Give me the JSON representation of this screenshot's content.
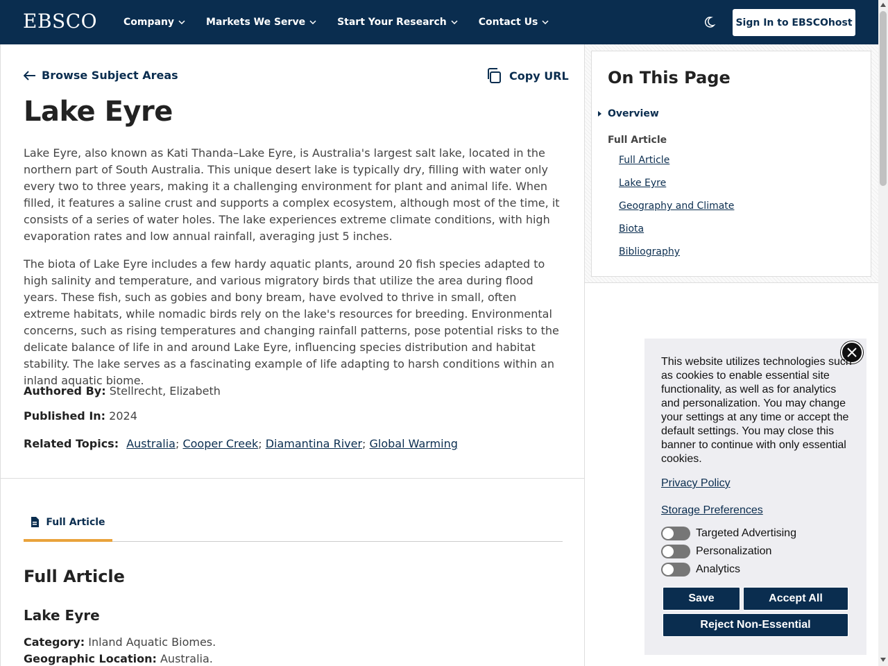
{
  "header": {
    "logo": "EBSCO",
    "nav": [
      "Company",
      "Markets We Serve",
      "Start Your Research",
      "Contact Us"
    ],
    "signin_label": "Sign In to EBSCOhost"
  },
  "article": {
    "back_label": "Browse Subject Areas",
    "copy_label": "Copy URL",
    "title": "Lake Eyre",
    "paragraph1": "Lake Eyre, also known as Kati Thanda–Lake Eyre, is Australia's largest salt lake, located in the northern part of South Australia. This unique desert lake is typically dry, filling with water only every two to three years, making it a challenging environment for plant and animal life. When filled, it features a saline crust and supports a complex ecosystem, although most of the time, it consists of a series of water holes. The lake experiences extreme climate conditions, with high evaporation rates and low annual rainfall, averaging just 5 inches.",
    "paragraph2": "The biota of Lake Eyre includes a few hardy aquatic plants, around 20 fish species adapted to high salinity and temperature, and various migratory birds that utilize the area during flood years. These fish, such as gobies and bony bream, have evolved to thrive in small, often extreme habitats, while nomadic birds rely on the lake's resources for breeding. Environmental concerns, such as rising temperatures and changing rainfall patterns, pose potential risks to the delicate balance of life in and around Lake Eyre, influencing species distribution and habitat stability. The lake serves as a fascinating example of life adapting to harsh conditions within an inland aquatic biome.",
    "authored_label": "Authored By:",
    "author": "Stellrecht, Elizabeth",
    "published_label": "Published In:",
    "published": "2024",
    "related_label": "Related Topics:",
    "related": [
      "Australia",
      "Cooper Creek",
      "Diamantina River",
      "Global Warming"
    ],
    "tab_label": "Full Article",
    "section_title": "Full Article",
    "subsection_title": "Lake Eyre",
    "category_label": "Category:",
    "category": "Inland Aquatic Biomes.",
    "location_label": "Geographic Location:",
    "location": "Australia."
  },
  "toc": {
    "title": "On This Page",
    "overview": "Overview",
    "section": "Full Article",
    "links": [
      "Full Article",
      "Lake Eyre",
      "Geography and Climate",
      "Biota",
      "Bibliography"
    ]
  },
  "cookie": {
    "text": "This website utilizes technologies such as cookies to enable essential site functionality, as well as for analytics and personalization. You may change your settings at any time or accept the default settings. You may close this banner to continue with only essential cookies.",
    "privacy": "Privacy Policy",
    "storage": "Storage Preferences",
    "prefs": [
      "Targeted Advertising",
      "Personalization",
      "Analytics"
    ],
    "save": "Save",
    "accept": "Accept All",
    "reject": "Reject Non-Essential"
  }
}
